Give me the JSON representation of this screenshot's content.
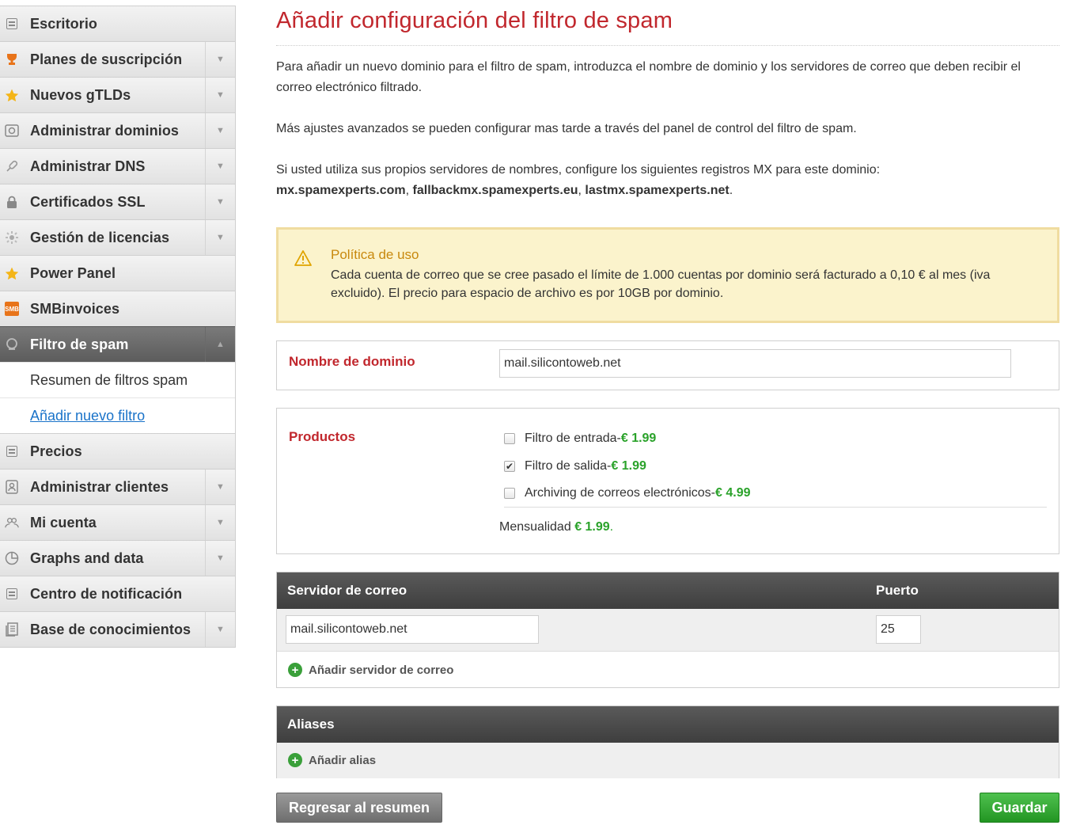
{
  "sidebar": {
    "items": [
      {
        "label": "Escritorio",
        "icon": "desktop-icon"
      },
      {
        "label": "Planes de suscripción",
        "icon": "trophy-icon"
      },
      {
        "label": "Nuevos gTLDs",
        "icon": "star-icon"
      },
      {
        "label": "Administrar dominios",
        "icon": "domain-icon"
      },
      {
        "label": "Administrar DNS",
        "icon": "dns-icon"
      },
      {
        "label": "Certificados SSL",
        "icon": "lock-icon"
      },
      {
        "label": "Gestión de licencias",
        "icon": "license-icon"
      },
      {
        "label": "Power Panel",
        "icon": "star-icon"
      },
      {
        "label": "SMBinvoices",
        "icon": "smb-icon",
        "badge": "SMB"
      },
      {
        "label": "Filtro de spam",
        "icon": "spam-filter-icon"
      }
    ],
    "subitems": [
      {
        "label": "Resumen de filtros spam"
      },
      {
        "label": "Añadir nuevo filtro"
      }
    ],
    "items_bottom": [
      {
        "label": "Precios",
        "icon": "pricing-icon"
      },
      {
        "label": "Administrar clientes",
        "icon": "clients-icon"
      },
      {
        "label": "Mi cuenta",
        "icon": "account-icon"
      },
      {
        "label": "Graphs and data",
        "icon": "pie-chart-icon"
      },
      {
        "label": "Centro de notificación",
        "icon": "notification-icon"
      },
      {
        "label": "Base de conocimientos",
        "icon": "knowledge-icon"
      }
    ],
    "expand_arrow": "▼",
    "collapse_arrow": "▲"
  },
  "main": {
    "title": "Añadir configuración del filtro de spam",
    "intro": "Para añadir un nuevo dominio para el filtro de spam, introduzca el nombre de dominio y los servidores de correo que deben recibir el correo electrónico filtrado.",
    "advanced": "Más ajustes avanzados se pueden configurar mas tarde a través del panel de control del filtro de spam.",
    "mx_intro": "Si usted utiliza sus propios servidores de nombres, configure los siguientes registros MX para este dominio:",
    "mx_records": [
      "mx.spamexperts.com",
      "fallbackmx.spamexperts.eu",
      "lastmx.spamexperts.net"
    ],
    "mx_sep": ", ",
    "mx_end": "."
  },
  "warning": {
    "title": "Política de uso",
    "text": "Cada cuenta de correo que se cree pasado el límite de 1.000 cuentas por dominio será facturado a 0,10 € al mes (iva excluido). El precio para espacio de archivo es por 10GB por dominio.",
    "color": "#fbf3cc"
  },
  "domain": {
    "label": "Nombre de dominio",
    "value": "mail.silicontoweb.net"
  },
  "products": {
    "label": "Productos",
    "items": [
      {
        "name": "Filtro de entrada",
        "sep": " - ",
        "price": "€ 1.99",
        "checked": false
      },
      {
        "name": "Filtro de salida",
        "sep": " - ",
        "price": "€ 1.99",
        "checked": true
      },
      {
        "name": "Archiving de correos electrónicos",
        "sep": " - ",
        "price": "€ 4.99",
        "checked": false
      }
    ],
    "monthly_label": "Mensualidad",
    "monthly_value": "€ 1.99",
    "monthly_end": "."
  },
  "mail_servers": {
    "col_server": "Servidor de correo",
    "col_port": "Puerto",
    "rows": [
      {
        "server": "mail.silicontoweb.net",
        "port": "25"
      }
    ],
    "add_label": "Añadir servidor de correo"
  },
  "aliases": {
    "header": "Aliases",
    "add_label": "Añadir alias"
  },
  "buttons": {
    "back": "Regresar al resumen",
    "save": "Guardar"
  },
  "colors": {
    "accent_red": "#c1272d",
    "price_green": "#2aa22a",
    "save_green": "#229522"
  }
}
